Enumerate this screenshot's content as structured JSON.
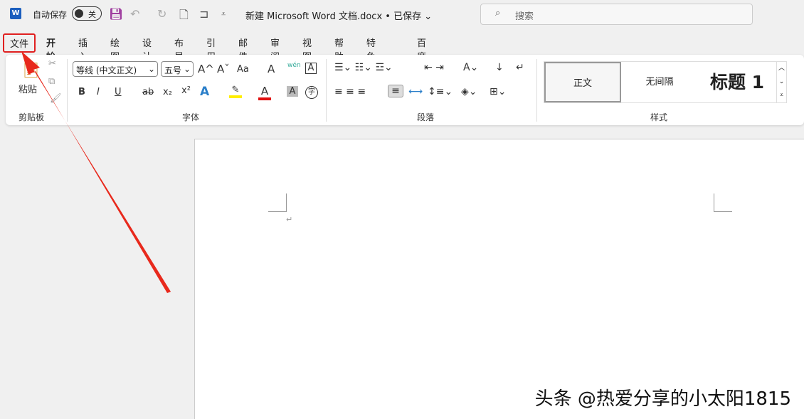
{
  "titlebar": {
    "app_icon": "W",
    "autosave_label": "自动保存",
    "autosave_state": "关",
    "doc_title": "新建 Microsoft Word 文档.docx • 已保存 ⌄",
    "search_placeholder": "搜索"
  },
  "tabs": [
    "文件",
    "开始",
    "插入",
    "绘图",
    "设计",
    "布局",
    "引用",
    "邮件",
    "审阅",
    "视图",
    "帮助",
    "特色功能",
    "百度网盘"
  ],
  "ribbon": {
    "clipboard": {
      "paste": "粘贴",
      "group": "剪贴板"
    },
    "font": {
      "font_name": "等线 (中文正文)",
      "font_size": "五号",
      "group": "字体",
      "grow": "A^",
      "shrink": "Aˇ",
      "case": "Aa",
      "bold": "B",
      "italic": "I",
      "underline": "U",
      "strike": "ab",
      "sub": "x₂",
      "sup": "x²",
      "effects": "A",
      "color": "A",
      "shade": "A",
      "phonetic": "wén",
      "enclose": "字",
      "border": "A"
    },
    "paragraph": {
      "group": "段落"
    },
    "styles": {
      "items": [
        "正文",
        "无间隔",
        "标题 1"
      ],
      "group": "样式"
    }
  },
  "watermark": "头条 @热爱分享的小太阳1815"
}
